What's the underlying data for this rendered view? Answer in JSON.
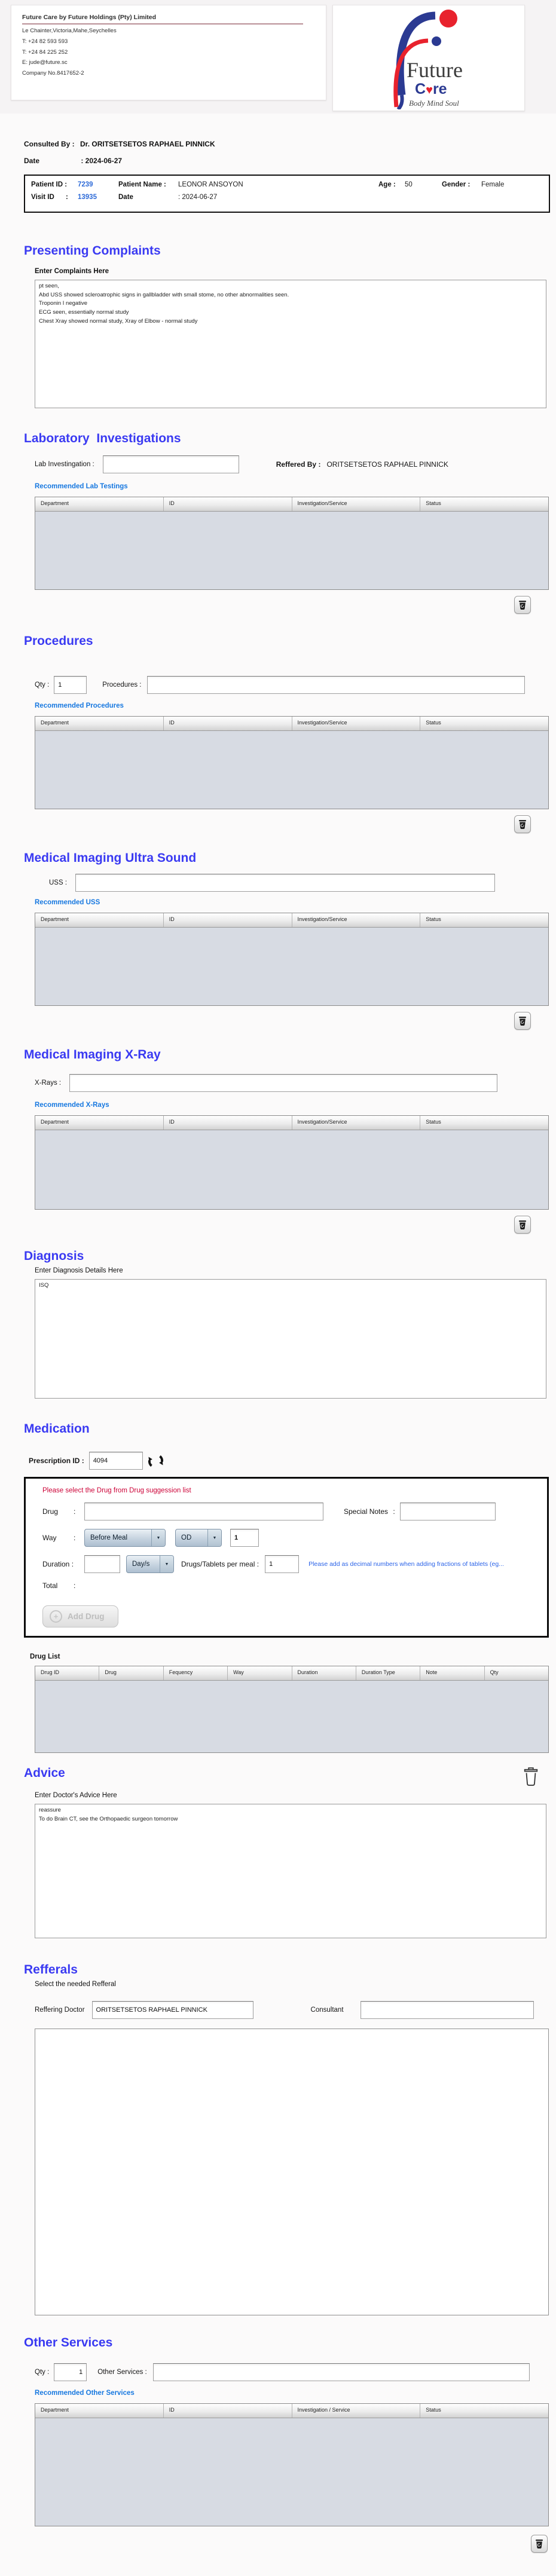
{
  "ui": {
    "colon": ":",
    "dropdown_arrow": "▼",
    "plus": "+"
  },
  "colors": {
    "heading_blue": "#3a3af2",
    "link_blue": "#1778e0",
    "id_blue": "#2e6bd8",
    "note_red": "#cc0036",
    "hint_blue": "#2c64e8",
    "table_body": "#d7dbe3",
    "logo_blue": "#2b3a92",
    "logo_red": "#e8222d"
  },
  "header": {
    "company_name": "Future Care by Future Holdings (Pty) Limited",
    "address": "Le Chainter,Victoria,Mahe,Seychelles",
    "phone1": "T: +24  82 593 593",
    "phone2": "T: +24  84 225 252",
    "email": "E: jude@future.sc",
    "company_no": "Company No.8417652-2",
    "logo": {
      "word1": "Future",
      "care_c": "C",
      "care_heart": "♥",
      "care_re": "re",
      "tagline": "Body Mind Soul"
    }
  },
  "consultation": {
    "consulted_by_label": "Consulted By  :",
    "consulted_by": "Dr.  ORITSETSETOS RAPHAEL PINNICK",
    "date_label": "Date",
    "date_value": ": 2024-06-27"
  },
  "patient": {
    "patient_id_label": "Patient ID  :",
    "patient_id": "7239",
    "patient_name_label": "Patient Name  :",
    "patient_name": "LEONOR ANSOYON",
    "age_label": "Age  :",
    "age": "50",
    "gender_label": "Gender   :",
    "gender": "Female",
    "visit_id_label": "Visit ID",
    "visit_id_colon": ":",
    "visit_id": "13935",
    "visit_date_label": "Date",
    "visit_date_value": ": 2024-06-27"
  },
  "presenting_complaints": {
    "title": "Presenting Complaints",
    "label": "Enter Complaints Here",
    "text": "pt seen,\nAbd USS showed scleroatrophic signs in gallbladder with small stome, no other abnormalities seen.\nTroponin I negative\nECG seen, essentially normal study\nChest Xray showed normal study, Xray of Elbow - normal study"
  },
  "laboratory": {
    "title": "Laboratory  Investigations",
    "input_label": "Lab Investingation :",
    "input_value": "",
    "referred_by_label": "Reffered By :",
    "referred_by": "ORITSETSETOS RAPHAEL PINNICK",
    "recommended_label": "Recommended Lab Testings",
    "table_headers": [
      "Department",
      "ID",
      "Investigation/Service",
      "Status"
    ]
  },
  "procedures": {
    "title": "Procedures",
    "qty_label": "Qty :",
    "qty": "1",
    "input_label": "Procedures :",
    "input_value": "",
    "recommended_label": "Recommended Procedures",
    "table_headers": [
      "Department",
      "ID",
      "Investigation/Service",
      "Status"
    ]
  },
  "ultrasound": {
    "title": "Medical Imaging Ultra Sound",
    "input_label": "USS :",
    "input_value": "",
    "recommended_label": "Recommended USS",
    "table_headers": [
      "Department",
      "ID",
      "Investigation/Service",
      "Status"
    ]
  },
  "xray": {
    "title": "Medical Imaging X-Ray",
    "input_label": "X-Rays :",
    "input_value": "",
    "recommended_label": "Recommended X-Rays",
    "table_headers": [
      "Department",
      "ID",
      "Investigation/Service",
      "Status"
    ]
  },
  "diagnosis": {
    "title": "Diagnosis",
    "label": "Enter Diagnosis Details Here",
    "text": "ISQ"
  },
  "medication": {
    "title": "Medication",
    "prescription_id_label": "Prescription ID :",
    "prescription_id": "4094",
    "note": "Please select the Drug from Drug suggession list",
    "drug_label": "Drug",
    "drug_value": "",
    "special_notes_label": "Special Notes",
    "special_notes_value": "",
    "way_label": "Way",
    "way_selected": "Before Meal",
    "frequency_selected": "OD",
    "frequency_value": "1",
    "duration_label": "Duration :",
    "duration_value": "",
    "duration_type_selected": "Day/s",
    "per_meal_label": "Drugs/Tablets per meal :",
    "per_meal_value": "1",
    "hint": "Please add as decimal numbers when adding fractions of tablets (eg...",
    "total_label": "Total",
    "add_drug_label": "Add Drug",
    "drug_list_label": "Drug List",
    "table_headers": [
      "Drug ID",
      "Drug",
      "Fequency",
      "Way",
      "Duration",
      "Duration Type",
      "Note",
      "Qty"
    ]
  },
  "advice": {
    "title": "Advice",
    "label": "Enter Doctor's Advice Here",
    "text": "reassure\nTo do Brain CT, see the Orthopaedic surgeon tomorrow"
  },
  "referrals": {
    "title": "Refferals",
    "label": "Select the needed Refferal",
    "referring_doctor_label": "Reffering Doctor",
    "referring_doctor": "ORITSETSETOS RAPHAEL PINNICK",
    "consultant_label": "Consultant",
    "consultant": ""
  },
  "other_services": {
    "title": "Other Services",
    "qty_label": "Qty :",
    "qty": "1",
    "input_label": "Other Services :",
    "input_value": "",
    "recommended_label": "Recommended Other Services",
    "table_headers": [
      "Department",
      "ID",
      "Investigation / Service",
      "Status"
    ]
  }
}
